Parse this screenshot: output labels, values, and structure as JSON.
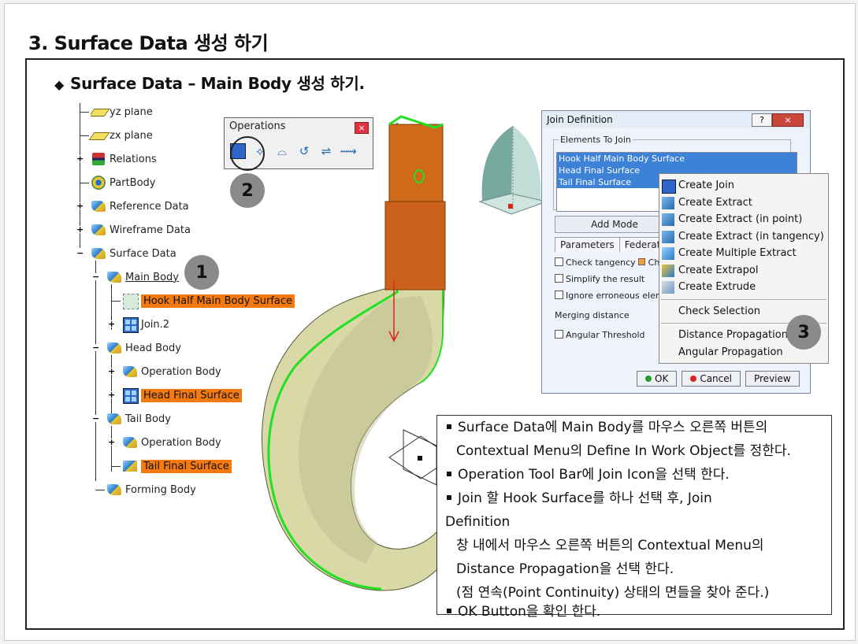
{
  "page": {
    "title": "3. Surface Data 생성 하기",
    "subtitle_bullet": "◆",
    "subtitle": "Surface Data – Main Body 생성 하기."
  },
  "tree": {
    "items": [
      {
        "label": "yz plane",
        "icon": "plane-icon"
      },
      {
        "label": "zx plane",
        "icon": "plane-icon"
      },
      {
        "label": "Relations",
        "icon": "relations-icon"
      },
      {
        "label": "PartBody",
        "icon": "gear-icon"
      },
      {
        "label": "Reference Data",
        "icon": "geometrical-set-icon"
      },
      {
        "label": "Wireframe Data",
        "icon": "geometrical-set-icon"
      },
      {
        "label": "Surface Data",
        "icon": "geometrical-set-icon"
      },
      {
        "label": "Main Body",
        "icon": "geometrical-set-icon"
      },
      {
        "label": "Hook Half Main Body Surface",
        "icon": "surface-icon"
      },
      {
        "label": "Join.2",
        "icon": "join-icon"
      },
      {
        "label": "Head Body",
        "icon": "geometrical-set-icon"
      },
      {
        "label": "Operation Body",
        "icon": "geometrical-set-icon"
      },
      {
        "label": "Head Final Surface",
        "icon": "join-icon"
      },
      {
        "label": "Tail Body",
        "icon": "geometrical-set-icon"
      },
      {
        "label": "Operation Body",
        "icon": "geometrical-set-icon"
      },
      {
        "label": "Tail Final Surface",
        "icon": "extrapol-icon"
      },
      {
        "label": "Forming Body",
        "icon": "geometrical-set-icon"
      }
    ]
  },
  "badges": {
    "one": "1",
    "two": "2",
    "three": "3"
  },
  "operations_toolbar": {
    "title": "Operations",
    "close": "×"
  },
  "join_dialog": {
    "title": "Join Definition",
    "help": "?",
    "close": "×",
    "group_label": "Elements To Join",
    "elements": [
      "Hook Half Main Body Surface",
      "Head Final Surface",
      "Tail Final Surface"
    ],
    "add_mode": "Add Mode",
    "tabs": [
      "Parameters",
      "Federation"
    ],
    "options": {
      "check_tangency": "Check tangency",
      "check_connexity": "Ch",
      "simplify": "Simplify the result",
      "ignore": "Ignore erroneous elem",
      "merging": "Merging distance",
      "angular": "Angular Threshold"
    },
    "buttons": {
      "ok": "OK",
      "cancel": "Cancel",
      "preview": "Preview"
    }
  },
  "context_menu": {
    "items": [
      "Create Join",
      "Create Extract",
      "Create Extract (in point)",
      "Create Extract (in tangency)",
      "Create Multiple Extract",
      "Create Extrapol",
      "Create Extrude"
    ],
    "check_selection": "Check Selection",
    "distance_propagation": "Distance Propagation",
    "angular_propagation": "Angular Propagation"
  },
  "instructions": {
    "l1": "Surface Data에 Main Body를 마우스 오른쪽 버튼의",
    "l2": "Contextual Menu의 Define In Work Object를 정한다.",
    "l3": "Operation Tool Bar에 Join Icon을 선택 한다.",
    "l4": "Join 할 Hook Surface를 하나 선택 후, Join",
    "l5": "Definition",
    "l6": "창 내에서 마우스 오른쪽 버튼의 Contextual Menu의",
    "l7": "Distance Propagation을 선택 한다.",
    "l8": "(점 연속(Point Continuity) 상태의 면들을 찾아 준다.)",
    "l9": "OK Button을 확인 한다."
  }
}
